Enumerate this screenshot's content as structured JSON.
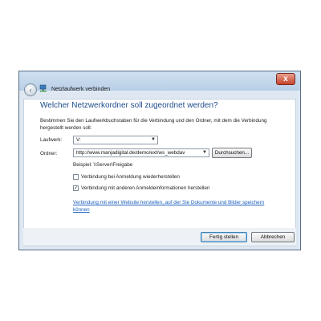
{
  "window": {
    "title": "Netzlaufwerk verbinden",
    "close_glyph": "x",
    "back_glyph": "‹"
  },
  "heading": "Welcher Netzwerkordner soll zugeordnet werden?",
  "description": "Bestimmen Sie den Laufwerkbuchstaben für die Verbindung und den Ordner, mit dem die Verbindung hergestellt werden soll:",
  "drive": {
    "label": "Laufwerk:",
    "value": "V:"
  },
  "folder": {
    "label": "Ordner:",
    "value": "http://www.manjadigital.de/demo/ext/ws_webdav",
    "browse_label": "Durchsuchen..."
  },
  "example": "Beispiel: \\\\Server\\Freigabe",
  "options": {
    "reconnect": {
      "label": "Verbindung bei Anmeldung wiederherstellen",
      "checked": false
    },
    "other_credentials": {
      "label": "Verbindung mit anderen Anmeldeinformationen herstellen",
      "checked": true,
      "mark": "✓"
    }
  },
  "link": "Verbindung mit einer Website herstellen, auf der Sie Dokumente und Bilder speichern können",
  "buttons": {
    "finish": "Fertig stellen",
    "cancel": "Abbrechen"
  },
  "icons": {
    "close": "close-icon",
    "back": "back-arrow-icon",
    "network": "network-drive-icon",
    "dropdown": "chevron-down-icon"
  }
}
